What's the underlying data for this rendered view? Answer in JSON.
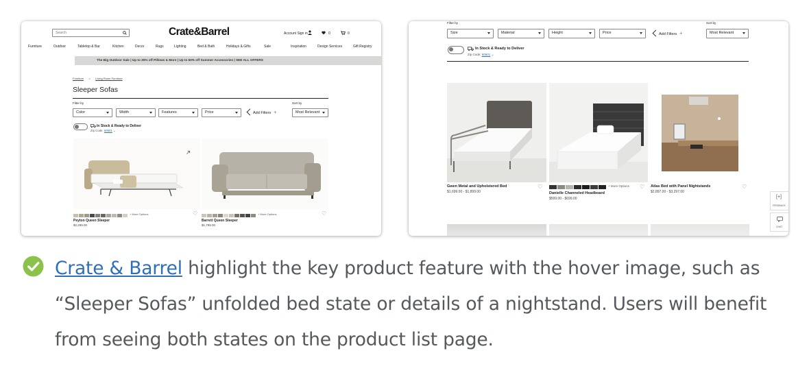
{
  "left": {
    "search_placeholder": "Search",
    "logo": "Crate&Barrel",
    "account_label": "Account Sign in",
    "wishlist_count": "0",
    "cart_count": "0",
    "nav": [
      "Furniture",
      "Outdoor",
      "Tabletop & Bar",
      "Kitchen",
      "Decor",
      "Rugs",
      "Lighting",
      "Bed & Bath",
      "Holidays & Gifts",
      "Sale",
      "Inspiration",
      "Design Services",
      "Gift Registry"
    ],
    "promo": "The Big Outdoor Sale  |  Up to 30% off Pillows & More  |  Up to 50% off Summer Accessories  |  SEE ALL OFFERS",
    "breadcrumb_1": "Furniture",
    "breadcrumb_sep": ">",
    "breadcrumb_2": "Living Room Furniture",
    "page_title": "Sleeper Sofas",
    "filter_by": "Filter by",
    "sort_by": "Sort by",
    "filters": [
      "Color",
      "Width",
      "Features",
      "Price"
    ],
    "add_filters": "Add Filters",
    "sort_value": "Most Relevant",
    "in_stock": "In Stock & Ready to Deliver",
    "zip_label": "Zip Code:",
    "zip_value": "60601",
    "more_options": "+ More Options",
    "products": [
      {
        "name": "Peyton Queen Sleeper",
        "price": "$2,299.00"
      },
      {
        "name": "Barrett Queen Sleeper",
        "price": "$1,799.00"
      }
    ]
  },
  "right": {
    "filter_by": "Filter by",
    "sort_by": "Sort by",
    "filters": [
      "Size",
      "Material",
      "Height",
      "Price"
    ],
    "add_filters": "Add Filters",
    "sort_value": "Most Relevant",
    "in_stock": "In Stock & Ready to Deliver",
    "zip_label": "Zip Code:",
    "zip_value": "60601",
    "more_options": "+ More Options",
    "products": [
      {
        "name": "Gwen Metal and Upholstered Bed",
        "price": "$1,699.00 - $1,899.00"
      },
      {
        "name": "Danielle Channeled Headboard",
        "price": "$599.00 - $699.00"
      },
      {
        "name": "Atlas Bed with Panel Nightstands",
        "price": "$2,897.00 - $3,297.00"
      }
    ],
    "feedback_label": "FEEDBACK",
    "chat_label": "CHAT"
  },
  "caption": {
    "link_text": "Crate & Barrel",
    "text": " highlight the key product feature with the hover image, such as “Sleeper Sofas” unfolded bed state or details of a nightstand. Users will benefit from seeing both states on the product list page."
  },
  "colors": {
    "link": "#2e6fb8",
    "check": "#8bc34a",
    "caption_text": "#55595e",
    "promo_bg": "#d8d8d6"
  },
  "icons": [
    "search-icon",
    "user-icon",
    "heart-icon",
    "cart-icon",
    "chevron-left-icon",
    "plus-icon",
    "truck-icon",
    "check-circle-icon",
    "expand-icon",
    "chat-icon"
  ]
}
